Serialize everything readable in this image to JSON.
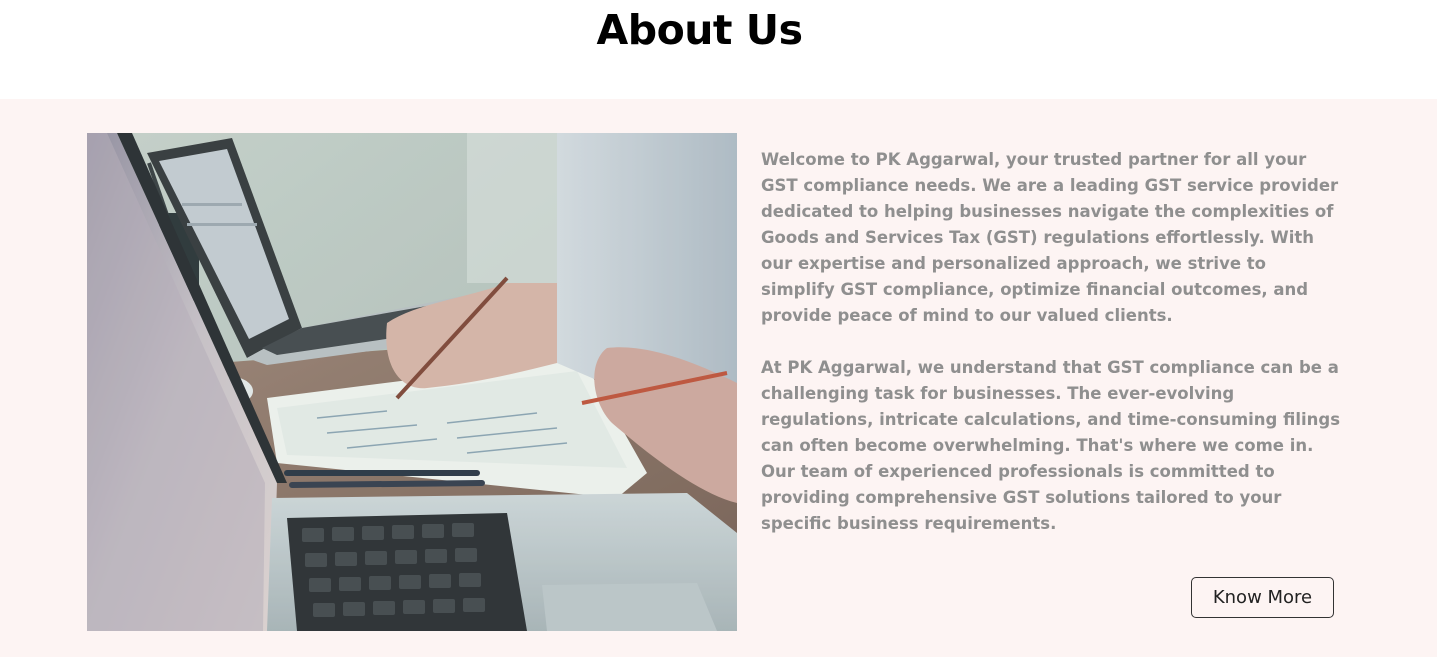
{
  "page": {
    "title": "About Us"
  },
  "about": {
    "paragraph_1": "Welcome to PK Aggarwal, your trusted partner for all your GST compliance needs. We are a leading GST service provider dedicated to helping businesses navigate the complexities of Goods and Services Tax (GST) regulations effortlessly. With our expertise and personalized approach, we strive to simplify GST compliance, optimize financial outcomes, and provide peace of mind to our valued clients.",
    "paragraph_2": "At PK Aggarwal, we understand that GST compliance can be a challenging task for businesses. The ever-evolving regulations, intricate calculations, and time-consuming filings can often become overwhelming. That's where we come in. Our team of experienced professionals is committed to providing comprehensive GST solutions tailored to your specific business requirements.",
    "button_label": "Know More"
  },
  "colors": {
    "section_background": "#fdf4f3",
    "body_text": "#8f8f8f",
    "heading_text": "#000000",
    "button_border": "#333333"
  }
}
